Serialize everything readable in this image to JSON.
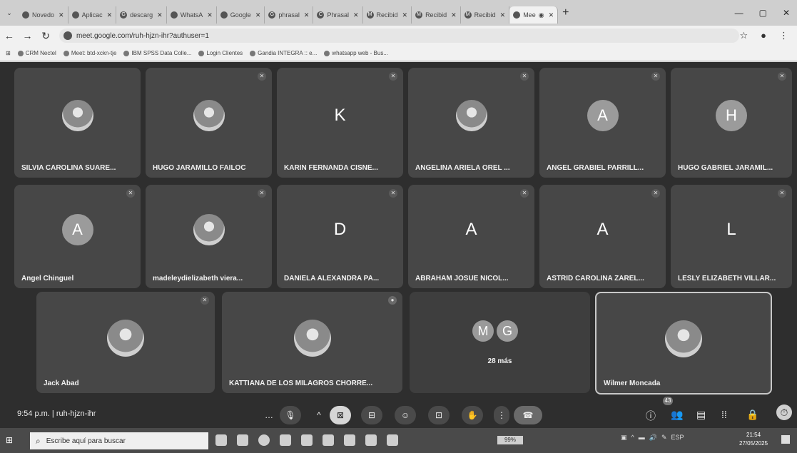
{
  "browser": {
    "tabs": [
      {
        "label": "Novedo",
        "favicon": "green-circle-icon"
      },
      {
        "label": "Aplicac",
        "favicon": "app-icon"
      },
      {
        "label": "descarg",
        "favicon": "google-icon"
      },
      {
        "label": "WhatsA",
        "favicon": "whatsapp-icon"
      },
      {
        "label": "Google",
        "favicon": "meet-icon"
      },
      {
        "label": "phrasal",
        "favicon": "google-icon"
      },
      {
        "label": "Phrasal",
        "favicon": "c-icon"
      },
      {
        "label": "Recibid",
        "favicon": "gmail-icon"
      },
      {
        "label": "Recibid",
        "favicon": "gmail-icon"
      },
      {
        "label": "Recibid",
        "favicon": "gmail-icon"
      },
      {
        "label": "Mee",
        "favicon": "meet-icon"
      }
    ],
    "url": "meet.google.com/ruh-hjzn-ihr?authuser=1",
    "bookmarks": [
      "CRM Nectel",
      "Meet: btd-xckn-tje",
      "IBM SPSS Data Colle...",
      "Login Clientes",
      "Gandia INTEGRA :: e...",
      "whatsapp web - Bus..."
    ]
  },
  "meet": {
    "participants_row1": [
      {
        "name": "SILVIA CAROLINA SUARE...",
        "avatar": "",
        "photo": true
      },
      {
        "name": "HUGO JARAMILLO FAILOC",
        "avatar": "",
        "photo": true
      },
      {
        "name": "KARIN FERNANDA CISNE...",
        "avatar": "K",
        "photo": false
      },
      {
        "name": "ANGELINA ARIELA OREL ...",
        "avatar": "",
        "photo": true
      },
      {
        "name": "ANGEL GRABIEL PARRILL...",
        "avatar": "A",
        "photo": false
      },
      {
        "name": "HUGO GABRIEL JARAMIL...",
        "avatar": "H",
        "photo": false
      }
    ],
    "participants_row2": [
      {
        "name": "Angel Chinguel",
        "avatar": "A",
        "photo": false
      },
      {
        "name": "madeleydielizabeth viera...",
        "avatar": "",
        "photo": true
      },
      {
        "name": "DANIELA ALEXANDRA PA...",
        "avatar": "D",
        "photo": false
      },
      {
        "name": "ABRAHAM JOSUE NICOL...",
        "avatar": "A",
        "photo": false
      },
      {
        "name": "ASTRID CAROLINA ZAREL...",
        "avatar": "A",
        "photo": false
      },
      {
        "name": "LESLY ELIZABETH VILLAR...",
        "avatar": "L",
        "photo": false
      }
    ],
    "participants_row3": [
      {
        "name": "Jack Abad"
      },
      {
        "name": "KATTIANA DE LOS MILAGROS CHORRE..."
      }
    ],
    "more": {
      "avatar1": "M",
      "avatar2": "G",
      "label": "28 más"
    },
    "speaker": {
      "name": "Wilmer Moncada"
    },
    "meeting_info": "9:54 p.m.  |  ruh-hjzn-ihr",
    "people_count": "43"
  },
  "taskbar": {
    "search_placeholder": "Escribe aquí para buscar",
    "battery": "99%",
    "lang": "ESP",
    "time": "21:54",
    "date": "27/05/2025"
  }
}
